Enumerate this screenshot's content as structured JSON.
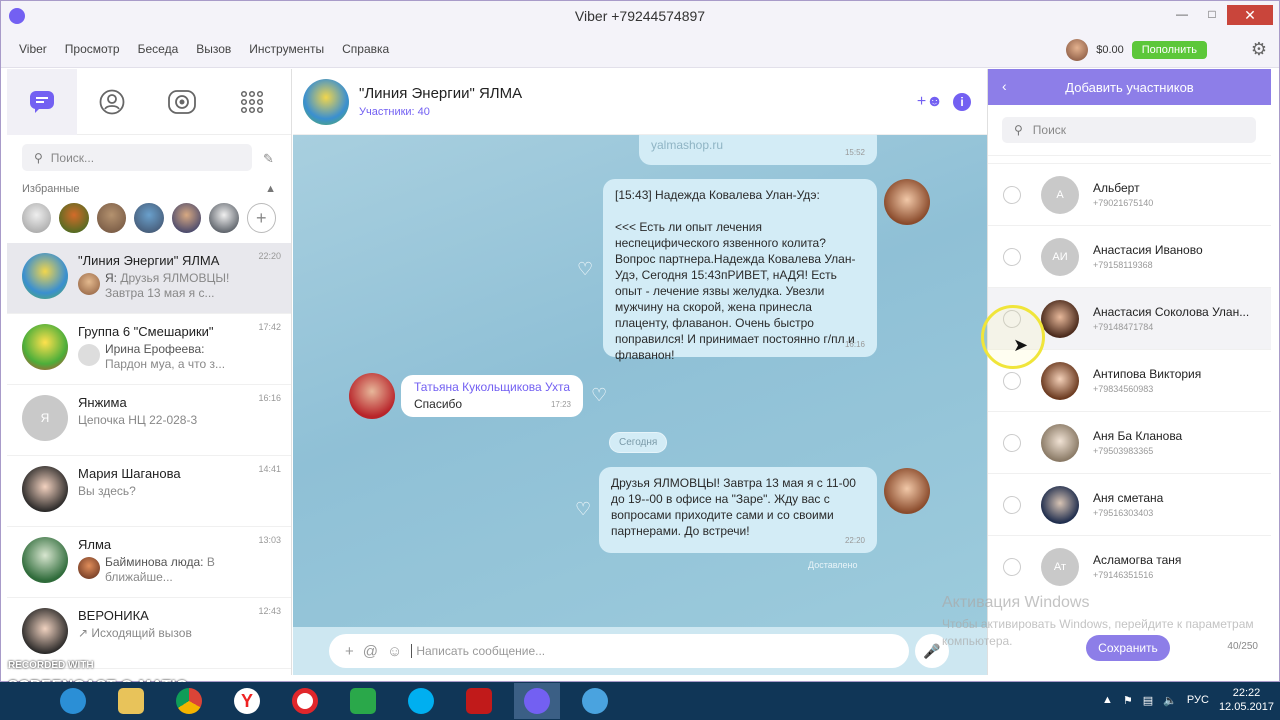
{
  "window": {
    "title": "Viber +79244574897"
  },
  "menu": [
    "Viber",
    "Просмотр",
    "Беседа",
    "Вызов",
    "Инструменты",
    "Справка"
  ],
  "account": {
    "balance": "$0.00",
    "topup_label": "Пополнить"
  },
  "left": {
    "search_placeholder": "Поиск...",
    "favorites_label": "Избранные",
    "chats": [
      {
        "name": "\"Линия Энергии\" ЯЛМА",
        "sender": "Я:",
        "preview_line1": "Друзья ЯЛМОВЦЫ!",
        "preview_line2": "Завтра 13 мая я с...",
        "time": "22:20"
      },
      {
        "name": "Группа 6 \"Смешарики\"",
        "sender": "Ирина Ерофеева:",
        "preview_line1": "",
        "preview_line2": "Пардон муа, а что з...",
        "time": "17:42"
      },
      {
        "name": "Янжима",
        "avatar_initial": "Я",
        "preview": "Цепочка НЦ 22-028-3",
        "time": "16:16"
      },
      {
        "name": "Мария Шаганова",
        "preview": "Вы здесь?",
        "time": "14:41"
      },
      {
        "name": "Ялма",
        "sender": "Байминова люда:",
        "preview_line1": "В",
        "preview_line2": "ближайше...",
        "time": "13:03"
      },
      {
        "name": "ВЕРОНИКА",
        "preview": "↗ Исходящий вызов",
        "time": "12:43"
      }
    ]
  },
  "conversation": {
    "title": "\"Линия Энергии\" ЯЛМА",
    "participants": "Участники: 40",
    "messages": [
      {
        "text": "yalmashop.ru",
        "time": "15:52"
      },
      {
        "header": "[15:43] Надежда Ковалева Улан-Удэ:",
        "text": "<<< Есть ли опыт лечения неспецифического язвенного колита? Вопрос партнера.Надежда Ковалева Улан-Удэ, Сегодня 15:43пРИВЕТ, нАДЯ!  Есть опыт - лечение язвы желудка. Увезли мужчину на скорой, жена принесла плаценту, флаванон. Очень быстро поправился!  И  принимает постоянно г/пл и флаванон!",
        "time": "16:16"
      },
      {
        "sender": "Татьяна Кукольщикова Ухта",
        "text": "Спасибо",
        "time": "17:23"
      },
      {
        "text": "Друзья ЯЛМОВЦЫ! Завтра 13 мая  я с 11-00 до 19--00 в офисе на \"Заре\". Жду вас с вопросами приходите сами и со своими партнерами. До встречи!",
        "time": "22:20"
      }
    ],
    "day_separator": "Сегодня",
    "delivered": "Доставлено",
    "input_placeholder": "Написать сообщение..."
  },
  "add_panel": {
    "title": "Добавить участников",
    "search_placeholder": "Поиск",
    "contacts": [
      {
        "name": "Альберт",
        "phone": "+79021675140",
        "initial": "А"
      },
      {
        "name": "Анастасия Иваново",
        "phone": "+79158119368",
        "initial": "АИ"
      },
      {
        "name": "Анастасия Соколова Улан...",
        "phone": "+79148471784"
      },
      {
        "name": "Антипова Виктория",
        "phone": "+79834560983"
      },
      {
        "name": "Аня Ба Кланова",
        "phone": "+79503983365"
      },
      {
        "name": "Аня сметана",
        "phone": "+79516303403"
      },
      {
        "name": "Асламогва таня",
        "phone": "+79146351516",
        "initial": "Ат"
      }
    ],
    "save_label": "Сохранить",
    "count": "40/250"
  },
  "watermark": {
    "line1": "Активация Windows",
    "line2": "Чтобы активировать Windows, перейдите к параметрам компьютера."
  },
  "recorder": {
    "line1": "RECORDED WITH",
    "line2": "SCREENCAST-O-MATIC"
  },
  "tray": {
    "lang": "РУС",
    "time": "22:22",
    "date": "12.05.2017"
  },
  "colors": {
    "accent": "#7360f2",
    "panel_header": "#8d7ee8",
    "topup": "#5cc73a",
    "taskbar": "#103657"
  }
}
